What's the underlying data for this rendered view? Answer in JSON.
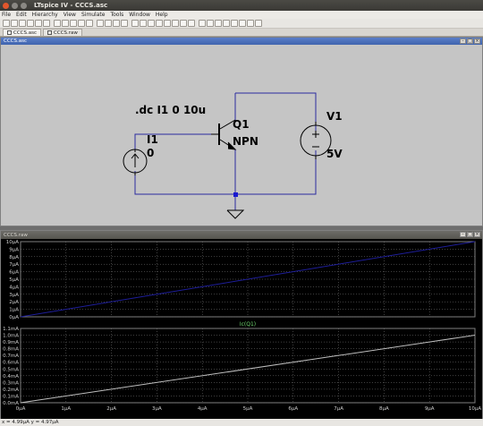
{
  "window": {
    "title": "LTspice IV - CCCS.asc"
  },
  "menu": [
    "File",
    "Edit",
    "Hierarchy",
    "View",
    "Simulate",
    "Tools",
    "Window",
    "Help"
  ],
  "tabs": [
    {
      "label": "CCCS.asc",
      "active": true
    },
    {
      "label": "CCCS.raw",
      "active": false
    }
  ],
  "schematic": {
    "window_title": "CCCS.asc",
    "directive": ".dc I1 0 10u",
    "transistor": {
      "name": "Q1",
      "model": "NPN"
    },
    "current_source": {
      "name": "I1",
      "value": "0"
    },
    "voltage_source": {
      "name": "V1",
      "value": "5V"
    },
    "colors": {
      "wire": "#2a2aa0",
      "component": "#000000",
      "junction": "#1a1ad0"
    }
  },
  "waveform": {
    "window_title": "CCCS.raw",
    "colors": {
      "background": "#000000",
      "grid": "#7f7f7f",
      "axis_text": "#cfcfcf",
      "trace_top": "#1e1e9a",
      "trace_bottom": "#bfbfbf",
      "label_bottom": "#6fd66f"
    }
  },
  "chart_data": [
    {
      "type": "line",
      "title": "",
      "series": [
        {
          "name": "",
          "x": [
            0,
            10
          ],
          "y": [
            0,
            10
          ]
        }
      ],
      "x_ticks": [
        "0µA",
        "1µA",
        "2µA",
        "3µA",
        "4µA",
        "5µA",
        "6µA",
        "7µA",
        "8µA",
        "9µA",
        "10µA"
      ],
      "y_ticks": [
        "0µA",
        "1µA",
        "2µA",
        "3µA",
        "4µA",
        "5µA",
        "6µA",
        "7µA",
        "8µA",
        "9µA",
        "10µA"
      ],
      "xlim": [
        0,
        10
      ],
      "ylim": [
        0,
        10
      ],
      "grid": true
    },
    {
      "type": "line",
      "title": "Ic(Q1)",
      "series": [
        {
          "name": "Ic(Q1)",
          "x": [
            0,
            10
          ],
          "y": [
            0,
            1.0
          ]
        }
      ],
      "x_ticks": [
        "0µA",
        "1µA",
        "2µA",
        "3µA",
        "4µA",
        "5µA",
        "6µA",
        "7µA",
        "8µA",
        "9µA",
        "10µA"
      ],
      "y_ticks": [
        "0.0mA",
        "0.1mA",
        "0.2mA",
        "0.3mA",
        "0.4mA",
        "0.5mA",
        "0.6mA",
        "0.7mA",
        "0.8mA",
        "0.9mA",
        "1.0mA",
        "1.1mA"
      ],
      "xlim": [
        0,
        10
      ],
      "ylim": [
        0,
        1.1
      ],
      "grid": true
    }
  ],
  "status": {
    "text": "x = 4.99µA    y = 4.97µA"
  }
}
